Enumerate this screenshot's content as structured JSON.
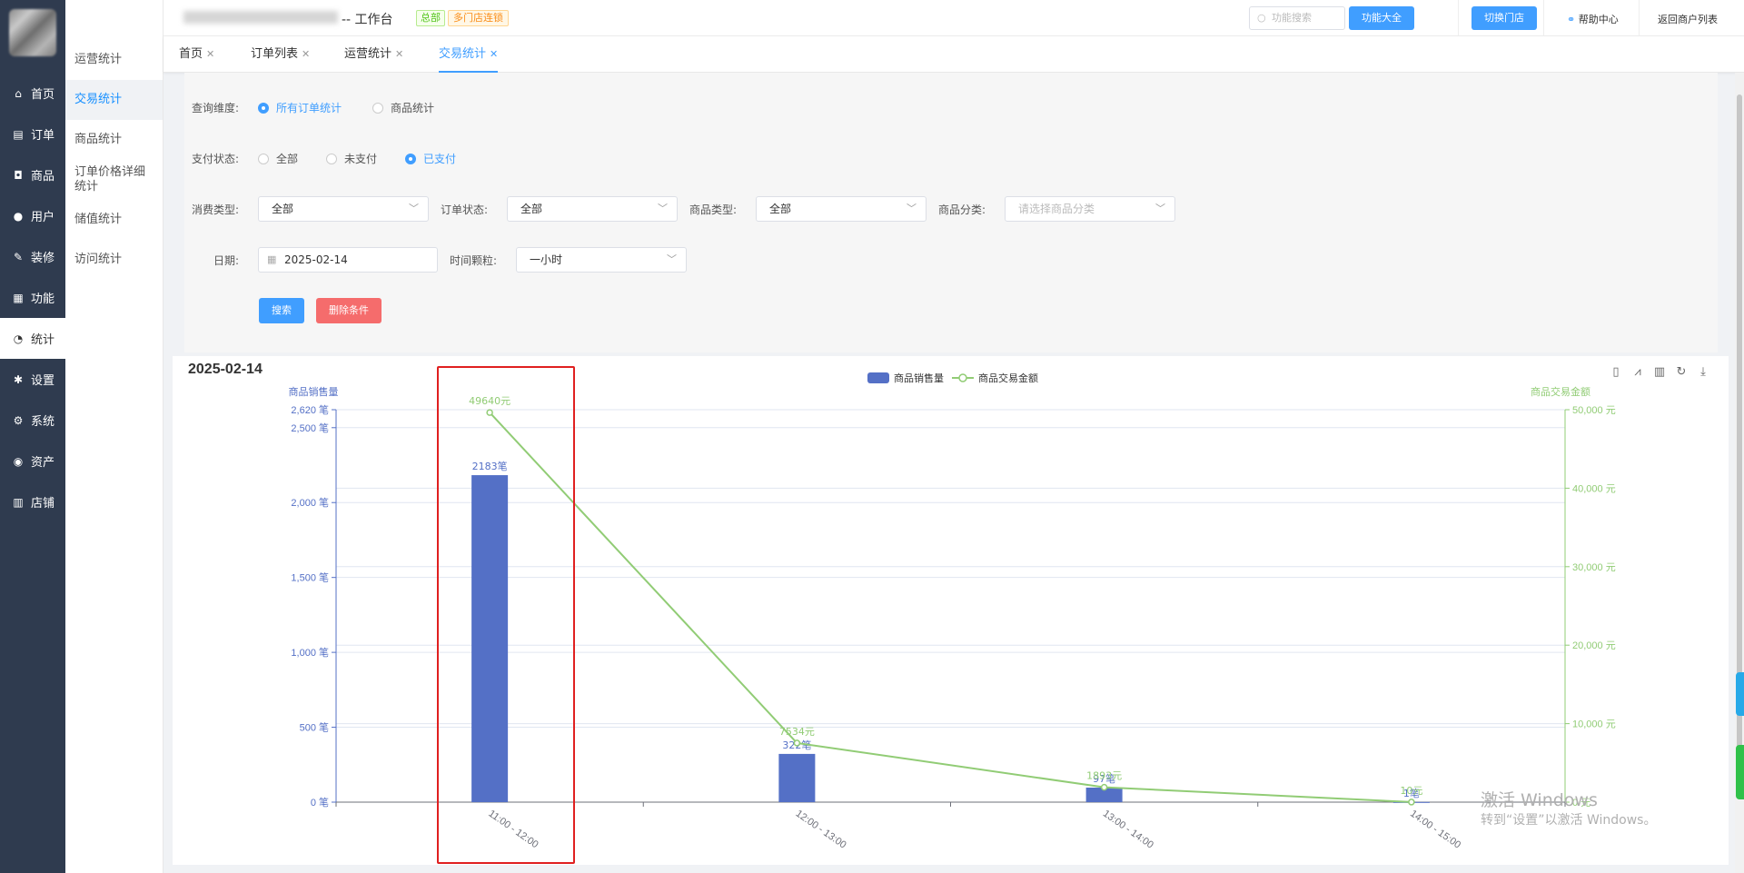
{
  "sidebar": {
    "items": [
      {
        "label": "首页",
        "icon": "home-icon",
        "glyph": "⌂"
      },
      {
        "label": "订单",
        "icon": "order-icon",
        "glyph": "▤"
      },
      {
        "label": "商品",
        "icon": "bag-icon",
        "glyph": "◘"
      },
      {
        "label": "用户",
        "icon": "user-icon",
        "glyph": "●"
      },
      {
        "label": "装修",
        "icon": "brush-icon",
        "glyph": "✎"
      },
      {
        "label": "功能",
        "icon": "grid-icon",
        "glyph": "▦"
      },
      {
        "label": "统计",
        "icon": "chart-icon",
        "glyph": "◔"
      },
      {
        "label": "设置",
        "icon": "gear-icon",
        "glyph": "✱"
      },
      {
        "label": "系统",
        "icon": "system-icon",
        "glyph": "⚙"
      },
      {
        "label": "资产",
        "icon": "asset-icon",
        "glyph": "◉"
      },
      {
        "label": "店铺",
        "icon": "shop-icon",
        "glyph": "▥"
      }
    ],
    "active_index": 6
  },
  "submenu": {
    "items": [
      "运营统计",
      "交易统计",
      "商品统计",
      "订单价格详细统计",
      "储值统计",
      "访问统计"
    ],
    "active_index": 1
  },
  "header": {
    "title": "-- 工作台",
    "tag_hq": "总部",
    "tag_chain": "多门店连锁",
    "search_placeholder": "功能搜索",
    "btn_features": "功能大全",
    "btn_switch_store": "切换门店",
    "help": "帮助中心",
    "back": "返回商户列表"
  },
  "tabs": [
    {
      "label": "首页",
      "active": false
    },
    {
      "label": "订单列表",
      "active": false
    },
    {
      "label": "运营统计",
      "active": false
    },
    {
      "label": "交易统计",
      "active": true
    }
  ],
  "filter": {
    "dimension_label": "查询维度:",
    "dimension_options": [
      {
        "label": "所有订单统计",
        "checked": true
      },
      {
        "label": "商品统计",
        "checked": false
      }
    ],
    "pay_label": "支付状态:",
    "pay_options": [
      {
        "label": "全部",
        "checked": false
      },
      {
        "label": "未支付",
        "checked": false
      },
      {
        "label": "已支付",
        "checked": true
      }
    ],
    "consume_label": "消费类型:",
    "consume_value": "全部",
    "order_status_label": "订单状态:",
    "order_status_value": "全部",
    "goods_type_label": "商品类型:",
    "goods_type_value": "全部",
    "goods_cat_label": "商品分类:",
    "goods_cat_placeholder": "请选择商品分类",
    "date_label": "日期:",
    "date_value": "2025-02-14",
    "granularity_label": "时间颗粒:",
    "granularity_value": "一小时",
    "btn_search": "搜索",
    "btn_delete": "删除条件"
  },
  "chart_data": {
    "type": "bar",
    "title": "2025-02-14",
    "categories": [
      "11:00 - 12:00",
      "12:00 - 13:00",
      "13:00 - 14:00",
      "14:00 - 15:00"
    ],
    "series": [
      {
        "name": "商品销售量",
        "type": "bar",
        "axis": "left",
        "values": [
          2183,
          322,
          97,
          1
        ],
        "labels": [
          "2183笔",
          "322笔",
          "97笔",
          "1笔"
        ],
        "color": "#5470c6"
      },
      {
        "name": "商品交易金额",
        "type": "line",
        "axis": "right",
        "values": [
          49640,
          7534,
          1893,
          10
        ],
        "labels": [
          "49640元",
          "7534元",
          "1893元",
          "10元"
        ],
        "color": "#91cc75"
      }
    ],
    "y_left": {
      "name": "商品销售量",
      "min": 0,
      "max": 2620,
      "ticks": [
        0,
        500,
        1000,
        1500,
        2000,
        2500,
        2620
      ],
      "tick_labels": [
        "0 笔",
        "500 笔",
        "1,000 笔",
        "1,500 笔",
        "2,000 笔",
        "2,500 笔",
        "2,620 笔"
      ]
    },
    "y_right": {
      "name": "商品交易金额",
      "min": 0,
      "max": 50000,
      "ticks": [
        0,
        10000,
        20000,
        30000,
        40000,
        50000
      ],
      "tick_labels": [
        "0 元",
        "10,000 元",
        "20,000 元",
        "30,000 元",
        "40,000 元",
        "50,000 元"
      ]
    },
    "legend_position": "top-center",
    "grid": true
  },
  "toolbox": [
    "data-view-icon",
    "line-chart-icon",
    "bar-chart-icon",
    "refresh-icon",
    "download-icon"
  ],
  "watermark": {
    "line1": "激活 Windows",
    "line2": "转到“设置”以激活 Windows。"
  },
  "colors": {
    "sidebar_bg": "#2f3b4f",
    "accent": "#409eff",
    "danger": "#f56c6c",
    "bar": "#5470c6",
    "line": "#91cc75"
  }
}
